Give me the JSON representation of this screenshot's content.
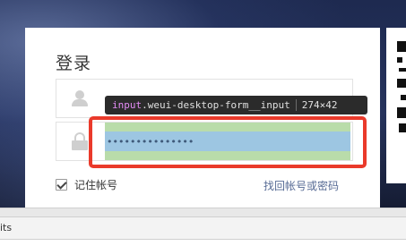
{
  "login": {
    "title": "登录",
    "username_value": "                ",
    "password_value": "•••••••••••••••",
    "remember_label": "记住帐号",
    "remember_checked": true,
    "forgot_label": "找回帐号或密码"
  },
  "inspector": {
    "tag": "input",
    "class_name": ".weui-desktop-form__input",
    "size": "274×42"
  },
  "devtools": {
    "tab_label": "its"
  },
  "colors": {
    "highlight_border": "#ea3a2b",
    "link": "#576b95"
  }
}
